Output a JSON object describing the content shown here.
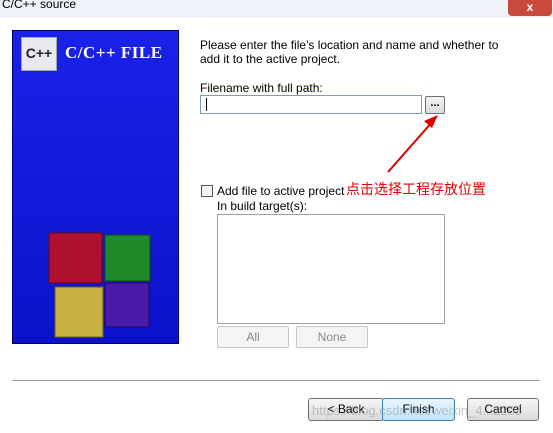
{
  "window": {
    "title": "C/C++ source",
    "close_glyph": "x"
  },
  "side_panel": {
    "title": "C/C++ FILE",
    "logo_text": "C++"
  },
  "description": "Please enter the file's location and name and whether to add it to the active project.",
  "filename": {
    "label": "Filename with full path:",
    "value": "",
    "browse_label": "..."
  },
  "add_to_project": {
    "label": "Add file to active project",
    "checked": false
  },
  "build_targets": {
    "label": "In build target(s):",
    "items": []
  },
  "target_buttons": {
    "all": "All",
    "none": "None"
  },
  "footer": {
    "back": "< Back",
    "finish": "Finish",
    "cancel": "Cancel"
  },
  "annotation": {
    "text": "点击选择工程存放位置",
    "color": "#e00000"
  },
  "watermark": "https://blog.csdn.net/weixin_4...2205",
  "colors": {
    "panel_blue": "#0b12c9",
    "cube_red": "#b01030",
    "cube_green": "#1e8a2a",
    "cube_yellow": "#c8b040",
    "cube_purple": "#4a1aa8"
  }
}
